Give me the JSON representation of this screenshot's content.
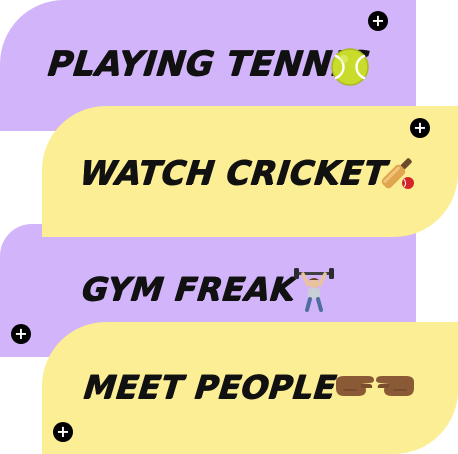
{
  "interests": [
    {
      "label": "PLAYING TENNIS",
      "icon": "tennis-ball-icon",
      "color": "#d2b4fb"
    },
    {
      "label": "WATCH CRICKET",
      "icon": "cricket-bat-icon",
      "color": "#fbee94"
    },
    {
      "label": "GYM FREAK",
      "icon": "weightlifter-icon",
      "color": "#d2b4fb"
    },
    {
      "label": "MEET PEOPLE",
      "icon": "handshake-hands-icon",
      "color": "#fbee94"
    }
  ],
  "add_button": {
    "symbol": "+"
  },
  "colors": {
    "purple": "#d2b4fb",
    "yellow": "#fbee94",
    "text": "#111111",
    "button": "#000000"
  }
}
